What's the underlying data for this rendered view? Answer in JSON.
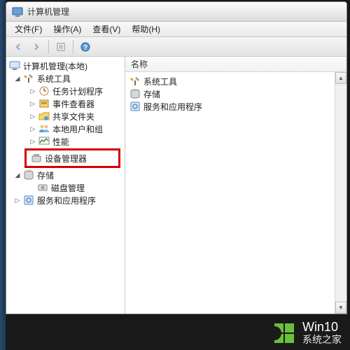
{
  "title": "计算机管理",
  "menus": {
    "file": "文件(F)",
    "action": "操作(A)",
    "view": "查看(V)",
    "help": "帮助(H)"
  },
  "tree": {
    "root": "计算机管理(本地)",
    "system_tools": "系统工具",
    "task_scheduler": "任务计划程序",
    "event_viewer": "事件查看器",
    "shared_folders": "共享文件夹",
    "local_users": "本地用户和组",
    "performance": "性能",
    "device_manager": "设备管理器",
    "storage": "存储",
    "disk_mgmt": "磁盘管理",
    "services_apps": "服务和应用程序"
  },
  "list": {
    "col_name": "名称",
    "system_tools": "系统工具",
    "storage": "存储",
    "services_apps": "服务和应用程序"
  },
  "watermark": {
    "line1": "Win10",
    "line2": "系统之家"
  }
}
